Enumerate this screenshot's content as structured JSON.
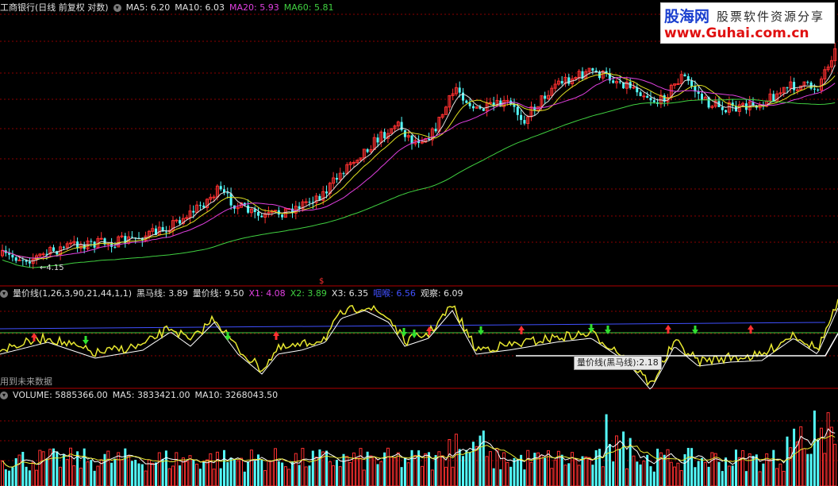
{
  "main": {
    "title": "工商银行(日线 前复权 对数)",
    "ma": [
      {
        "label": "MA5: 6.20",
        "color": "#e0e0e0"
      },
      {
        "label": "MA10: 6.03",
        "color": "#e0e020"
      },
      {
        "label": "MA20: 5.93",
        "color": "#e040e0"
      },
      {
        "label": "MA60: 5.81",
        "color": "#40d040"
      }
    ],
    "low_marker": "←4.15",
    "dollar_mark": "$"
  },
  "indicator": {
    "title": "量价线(1,26,3,90,21,44,1,1)",
    "values": [
      {
        "label": "黑马线: 3.89",
        "color": "#e0e0e0"
      },
      {
        "label": "量价线: 9.50",
        "color": "#e0e0e0"
      },
      {
        "label": "X1: 4.08",
        "color": "#e040e0"
      },
      {
        "label": "X2: 3.89",
        "color": "#40d040"
      },
      {
        "label": "X3: 6.35",
        "color": "#e0e0e0"
      },
      {
        "label": "咽喉: 6.56",
        "color": "#4050ff"
      },
      {
        "label": "观察: 6.09",
        "color": "#e0e0e0"
      }
    ],
    "note": "用到未来数据",
    "tooltip": "量价线(黑马线):2.18"
  },
  "volume": {
    "values": [
      {
        "label": "VOLUME: 5885366.00",
        "color": "#e0e0e0"
      },
      {
        "label": "MA5: 3833421.00",
        "color": "#e0e0e0"
      },
      {
        "label": "MA10: 3268043.50",
        "color": "#e0e0e0"
      }
    ]
  },
  "logo": {
    "brand": "股海网",
    "slogan": "股票软件资源分享",
    "url": "www.Guhai.com.cn"
  },
  "colors": {
    "up": "#ff3030",
    "down": "#54fcfc",
    "ma5": "#e0e0e0",
    "ma10": "#e0e020",
    "ma20": "#e040e0",
    "ma60": "#40d040",
    "grid": "#8b0000"
  }
}
